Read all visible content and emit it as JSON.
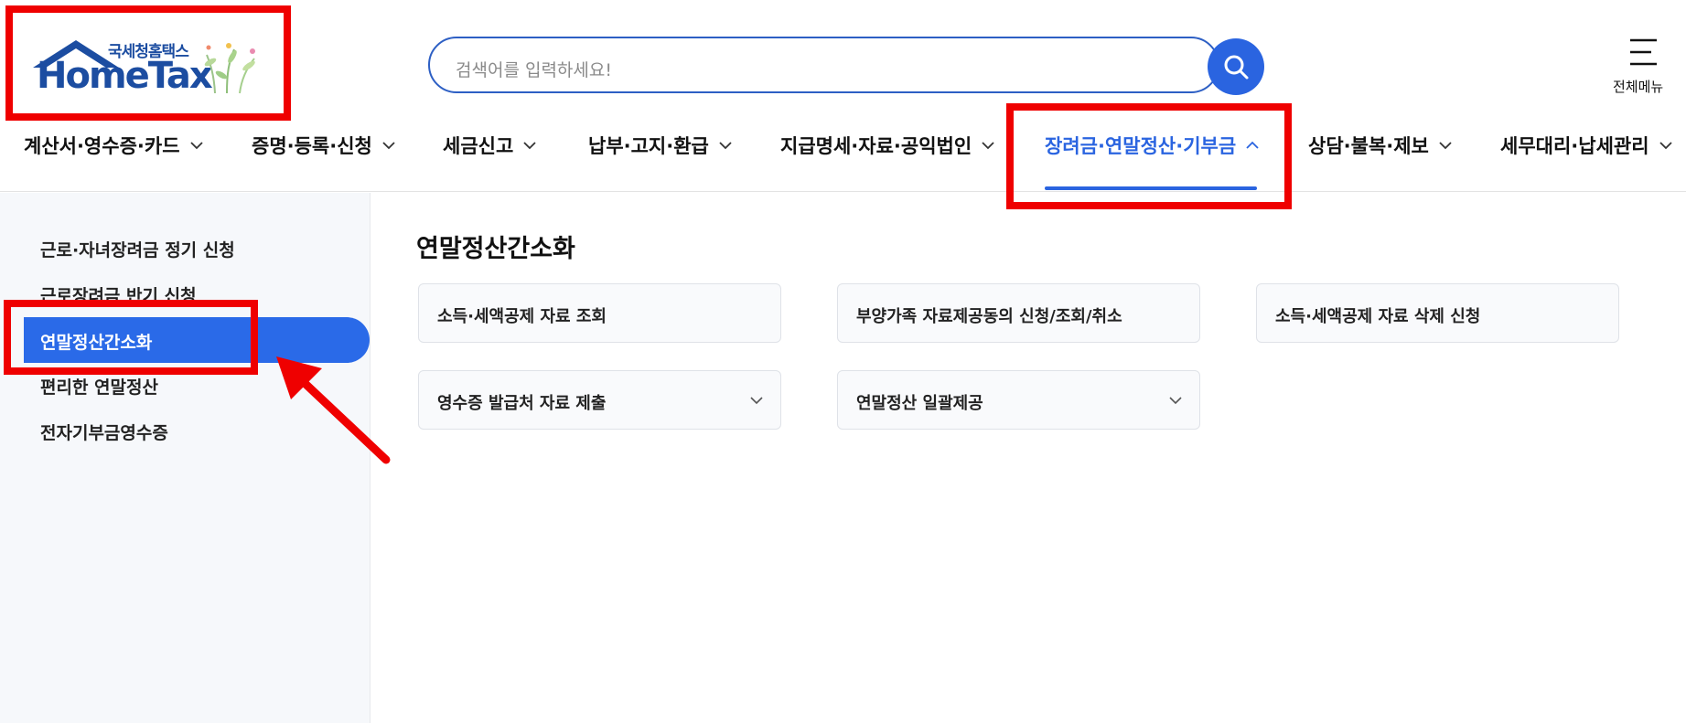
{
  "header": {
    "logo_sub": "국세청홈택스",
    "logo_main": "HomeTax",
    "search_placeholder": "검색어를 입력하세요!",
    "full_menu_label": "전체메뉴"
  },
  "nav": {
    "items": [
      {
        "label": "계산서·영수증·카드"
      },
      {
        "label": "증명·등록·신청"
      },
      {
        "label": "세금신고"
      },
      {
        "label": "납부·고지·환급"
      },
      {
        "label": "지급명세·자료·공익법인"
      },
      {
        "label": "장려금·연말정산·기부금",
        "active": true
      },
      {
        "label": "상담·불복·제보"
      },
      {
        "label": "세무대리·납세관리"
      }
    ]
  },
  "sidebar": {
    "items": [
      {
        "label": "근로·자녀장려금 정기 신청"
      },
      {
        "label": "근로장려금 반기 신청"
      },
      {
        "label": "연말정산간소화",
        "active": true
      },
      {
        "label": "편리한 연말정산"
      },
      {
        "label": "전자기부금영수증"
      }
    ]
  },
  "main": {
    "title": "연말정산간소화",
    "cards": [
      {
        "label": "소득·세액공제 자료 조회"
      },
      {
        "label": "부양가족 자료제공동의 신청/조회/취소"
      },
      {
        "label": "소득·세액공제 자료 삭제 신청"
      },
      {
        "label": "영수증 발급처 자료 제출",
        "expandable": true
      },
      {
        "label": "연말정산 일괄제공",
        "expandable": true
      }
    ]
  },
  "colors": {
    "accent": "#2a64e0",
    "annotation": "#ef0000",
    "brand": "#1c4da1"
  }
}
